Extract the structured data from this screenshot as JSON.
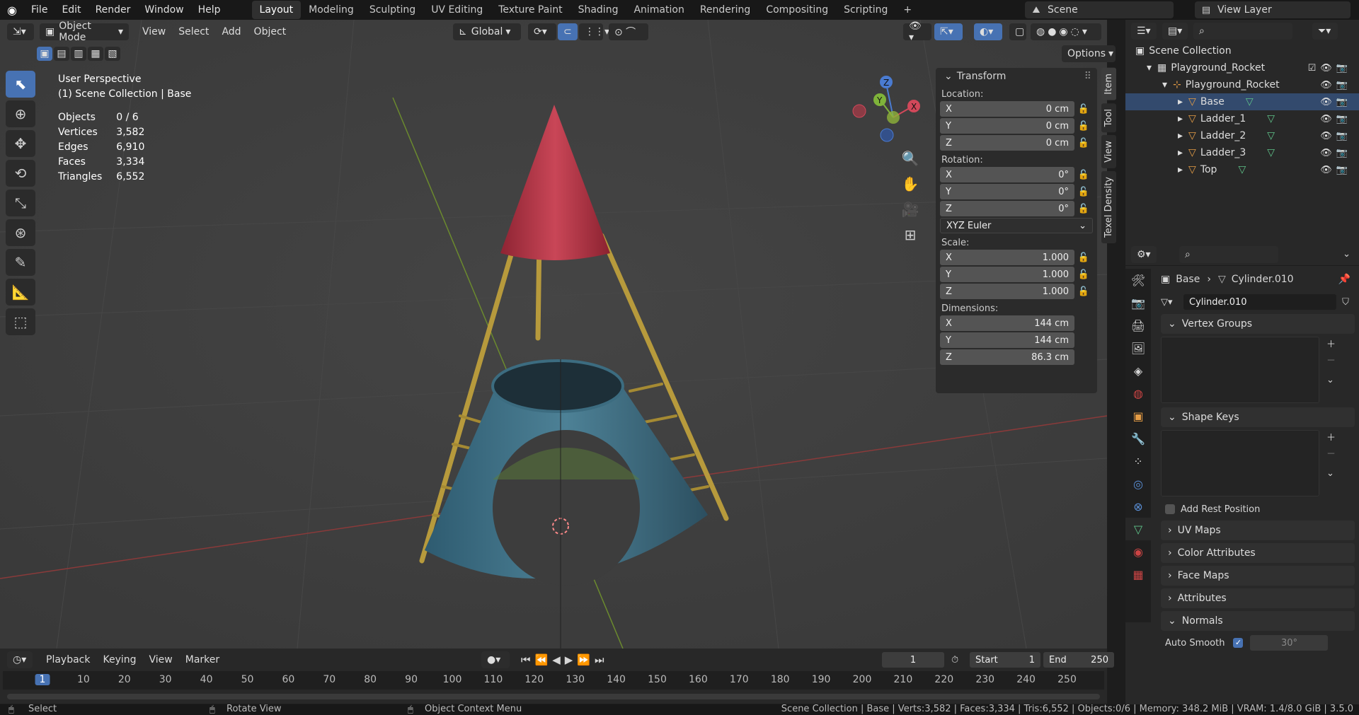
{
  "topbar": {
    "menus": [
      "File",
      "Edit",
      "Render",
      "Window",
      "Help"
    ],
    "workspaces": [
      "Layout",
      "Modeling",
      "Sculpting",
      "UV Editing",
      "Texture Paint",
      "Shading",
      "Animation",
      "Rendering",
      "Compositing",
      "Scripting"
    ],
    "active_workspace": "Layout",
    "add_tab": "+",
    "scene": "Scene",
    "view_layer": "View Layer"
  },
  "viewport_header": {
    "mode": "Object Mode",
    "menus": [
      "View",
      "Select",
      "Add",
      "Object"
    ],
    "orientation": "Global",
    "options": "Options"
  },
  "viewport": {
    "perspective": "User Perspective",
    "context": "(1) Scene Collection | Base",
    "stats": [
      {
        "label": "Objects",
        "value": "0 / 6"
      },
      {
        "label": "Vertices",
        "value": "3,582"
      },
      {
        "label": "Edges",
        "value": "6,910"
      },
      {
        "label": "Faces",
        "value": "3,334"
      },
      {
        "label": "Triangles",
        "value": "6,552"
      }
    ],
    "gizmo": {
      "x": "X",
      "y": "Y",
      "z": "Z"
    }
  },
  "transform": {
    "title": "Transform",
    "location_label": "Location:",
    "location": [
      {
        "axis": "X",
        "value": "0 cm"
      },
      {
        "axis": "Y",
        "value": "0 cm"
      },
      {
        "axis": "Z",
        "value": "0 cm"
      }
    ],
    "rotation_label": "Rotation:",
    "rotation": [
      {
        "axis": "X",
        "value": "0°"
      },
      {
        "axis": "Y",
        "value": "0°"
      },
      {
        "axis": "Z",
        "value": "0°"
      }
    ],
    "rotation_mode": "XYZ Euler",
    "scale_label": "Scale:",
    "scale": [
      {
        "axis": "X",
        "value": "1.000"
      },
      {
        "axis": "Y",
        "value": "1.000"
      },
      {
        "axis": "Z",
        "value": "1.000"
      }
    ],
    "dimensions_label": "Dimensions:",
    "dimensions": [
      {
        "axis": "X",
        "value": "144 cm"
      },
      {
        "axis": "Y",
        "value": "144 cm"
      },
      {
        "axis": "Z",
        "value": "86.3 cm"
      }
    ]
  },
  "side_tabs": [
    "Item",
    "Tool",
    "View",
    "Texel Density"
  ],
  "outliner": {
    "root": "Scene Collection",
    "collection": "Playground_Rocket",
    "empty": "Playground_Rocket",
    "objects": [
      "Base",
      "Ladder_1",
      "Ladder_2",
      "Ladder_3",
      "Top"
    ]
  },
  "properties": {
    "breadcrumb_object": "Base",
    "breadcrumb_mesh": "Cylinder.010",
    "mesh_name": "Cylinder.010",
    "panels": {
      "vertex_groups": "Vertex Groups",
      "shape_keys": "Shape Keys",
      "add_rest_position": "Add Rest Position",
      "uv_maps": "UV Maps",
      "color_attributes": "Color Attributes",
      "face_maps": "Face Maps",
      "attributes": "Attributes",
      "normals": "Normals",
      "auto_smooth": "Auto Smooth",
      "auto_smooth_angle": "30°"
    }
  },
  "timeline": {
    "menus": [
      "Playback",
      "Keying",
      "View",
      "Marker"
    ],
    "current_frame": "1",
    "start_label": "Start",
    "start": "1",
    "end_label": "End",
    "end": "250",
    "ticks": [
      "1",
      "10",
      "20",
      "30",
      "40",
      "50",
      "60",
      "70",
      "80",
      "90",
      "100",
      "110",
      "120",
      "130",
      "140",
      "150",
      "160",
      "170",
      "180",
      "190",
      "200",
      "210",
      "220",
      "230",
      "240",
      "250"
    ]
  },
  "statusbar": {
    "select": "Select",
    "rotate": "Rotate View",
    "context_menu": "Object Context Menu",
    "info": "Scene Collection | Base | Verts:3,582 | Faces:3,334 | Tris:6,552 | Objects:0/6 | Memory: 348.2 MiB | VRAM: 1.4/8.0 GiB | 3.5.0"
  },
  "colors": {
    "accent": "#4772b3",
    "viewport_bg": "#3d3d3d",
    "panel_bg": "#2b2b2b",
    "rocket_top": "#c0394a",
    "rocket_base": "#3f6f86",
    "ladder": "#b79a3c"
  }
}
